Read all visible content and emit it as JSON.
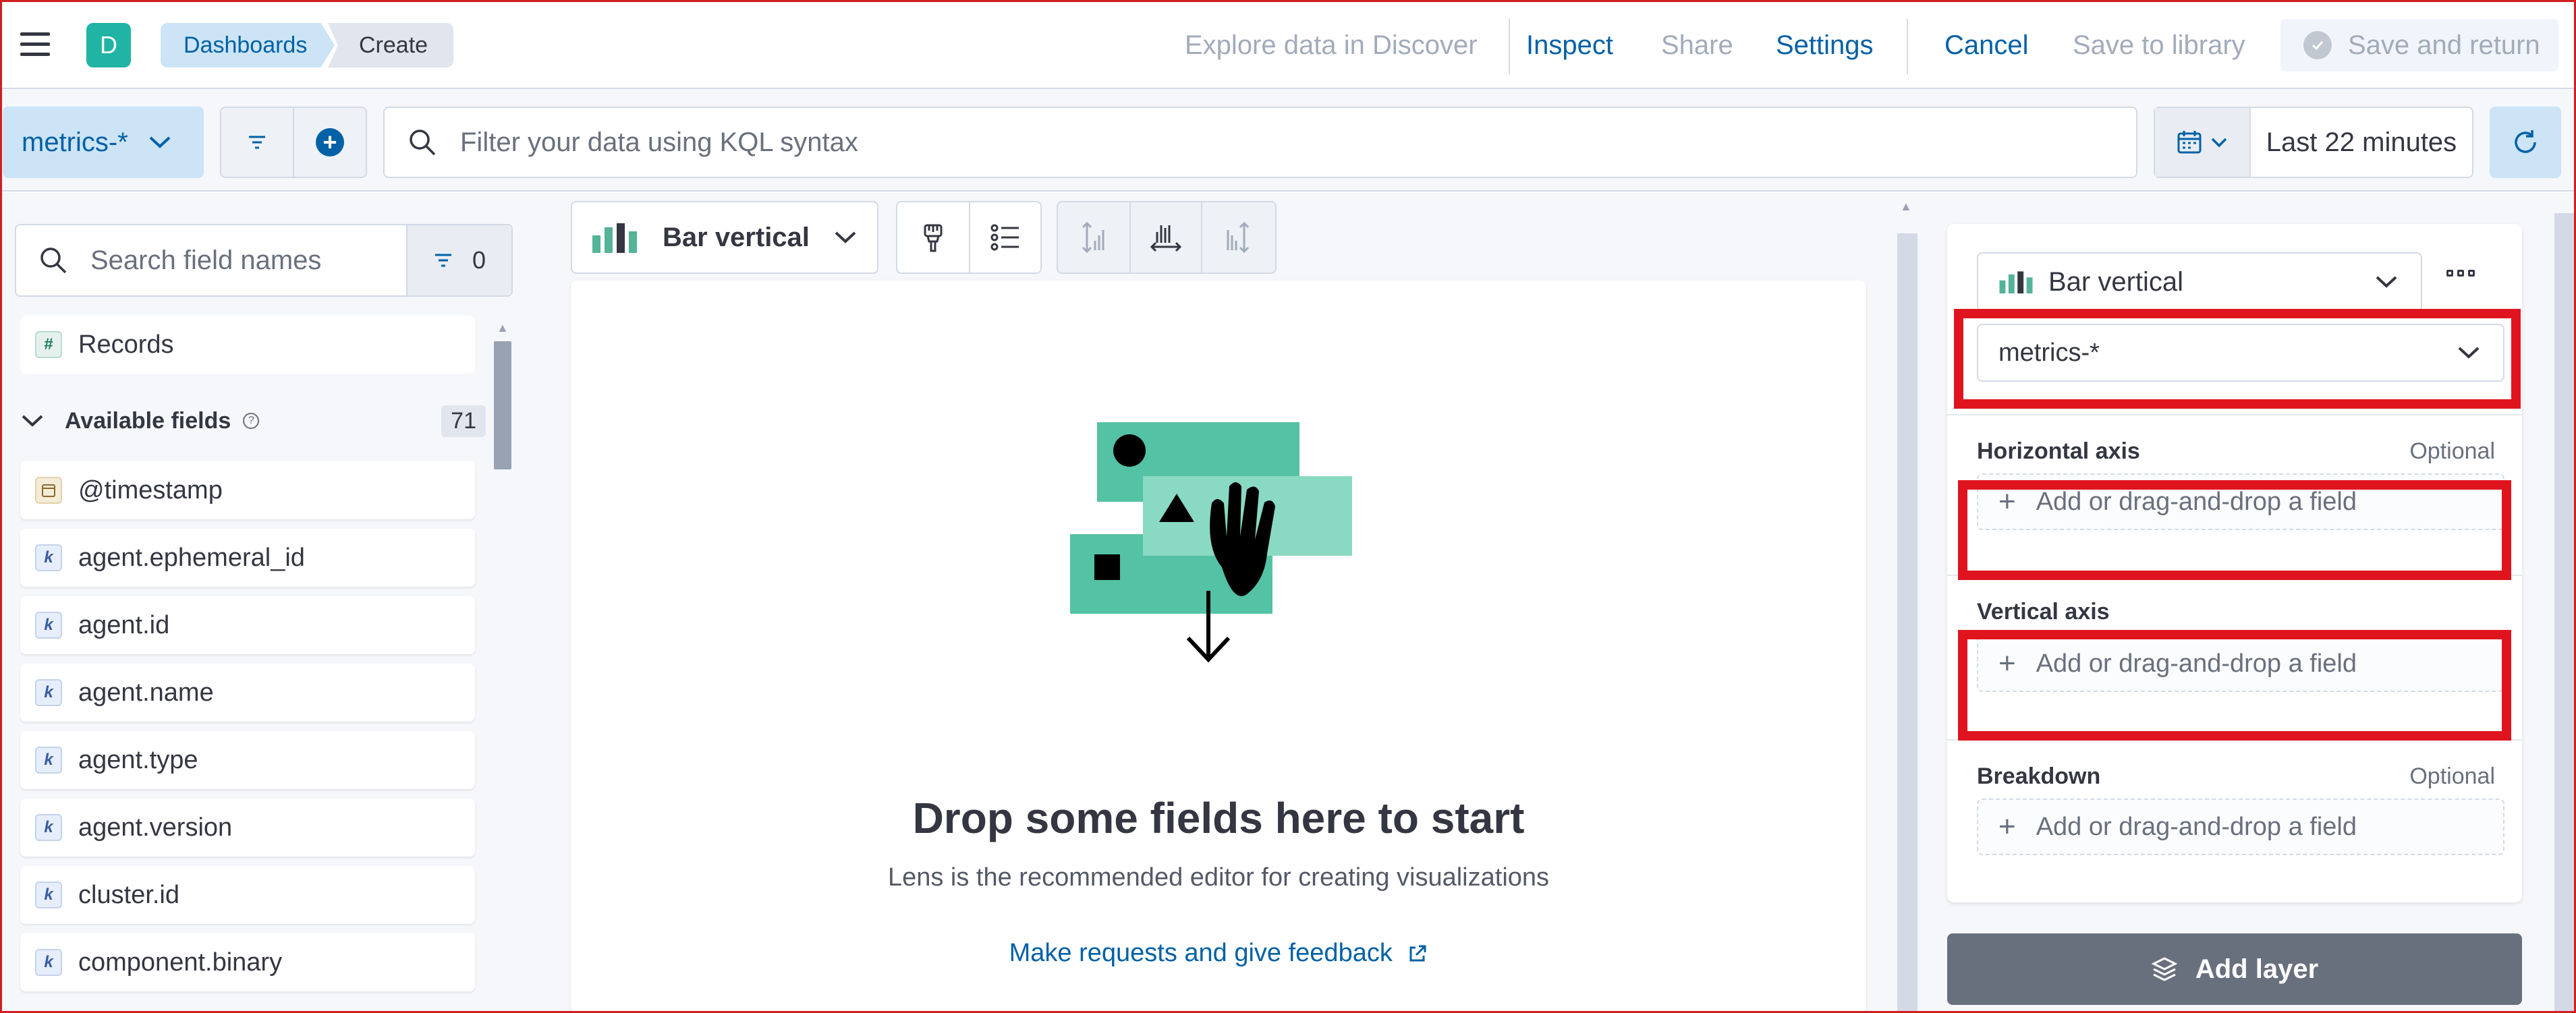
{
  "header": {
    "space_initial": "D",
    "breadcrumbs": [
      "Dashboards",
      "Create"
    ],
    "explore_link": "Explore data in Discover",
    "inspect": "Inspect",
    "share": "Share",
    "settings": "Settings",
    "cancel": "Cancel",
    "save_to_library": "Save to library",
    "save_and_return": "Save and return"
  },
  "querybar": {
    "data_view": "metrics-*",
    "kql_placeholder": "Filter your data using KQL syntax",
    "time_range": "Last 22 minutes"
  },
  "fieldlist": {
    "search_placeholder": "Search field names",
    "filter_count": "0",
    "records_label": "Records",
    "available_label": "Available fields",
    "available_count": "71",
    "fields": [
      {
        "name": "@timestamp",
        "type": "date"
      },
      {
        "name": "agent.ephemeral_id",
        "type": "keyword"
      },
      {
        "name": "agent.id",
        "type": "keyword"
      },
      {
        "name": "agent.name",
        "type": "keyword"
      },
      {
        "name": "agent.type",
        "type": "keyword"
      },
      {
        "name": "agent.version",
        "type": "keyword"
      },
      {
        "name": "cluster.id",
        "type": "keyword"
      },
      {
        "name": "component.binary",
        "type": "keyword"
      }
    ]
  },
  "workspace": {
    "chart_type": "Bar vertical",
    "empty_title": "Drop some fields here to start",
    "empty_subtitle": "Lens is the recommended editor for creating visualizations",
    "feedback_link": "Make requests and give feedback"
  },
  "config": {
    "chart_type": "Bar vertical",
    "data_view": "metrics-*",
    "horizontal_label": "Horizontal axis",
    "horizontal_optional": "Optional",
    "vertical_label": "Vertical axis",
    "breakdown_label": "Breakdown",
    "breakdown_optional": "Optional",
    "drop_placeholder": "Add or drag-and-drop a field",
    "add_layer": "Add layer"
  },
  "colors": {
    "primary": "#0061a6",
    "accent_teal": "#54c2a4",
    "highlight": "#e0141e"
  }
}
